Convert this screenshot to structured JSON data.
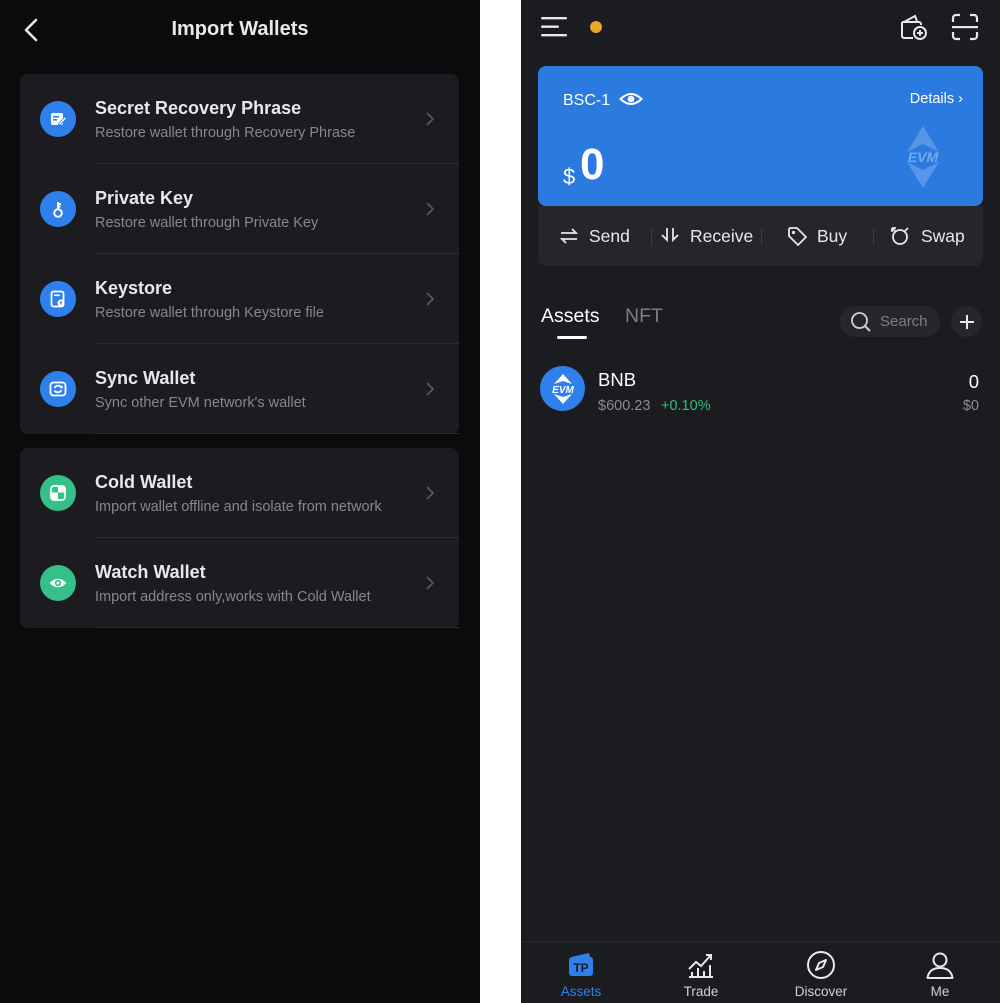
{
  "import": {
    "title": "Import Wallets",
    "groups": [
      [
        {
          "title": "Secret Recovery Phrase",
          "subtitle": "Restore wallet through Recovery Phrase",
          "icon": "document-edit-icon"
        },
        {
          "title": "Private Key",
          "subtitle": "Restore wallet through Private Key",
          "icon": "key-icon"
        },
        {
          "title": "Keystore",
          "subtitle": "Restore wallet through Keystore file",
          "icon": "keystore-file-icon"
        },
        {
          "title": "Sync Wallet",
          "subtitle": "Sync other EVM network's wallet",
          "icon": "sync-icon"
        }
      ],
      [
        {
          "title": "Cold Wallet",
          "subtitle": "Import wallet offline and isolate from network",
          "icon": "cold-wallet-icon"
        },
        {
          "title": "Watch Wallet",
          "subtitle": "Import address only,works with Cold Wallet",
          "icon": "eye-icon"
        }
      ]
    ]
  },
  "wallet": {
    "name": "BSC-1",
    "details_label": "Details",
    "currency": "$",
    "balance": "0",
    "actions": {
      "send": "Send",
      "receive": "Receive",
      "buy": "Buy",
      "swap": "Swap"
    },
    "tabs": {
      "assets": "Assets",
      "nft": "NFT"
    },
    "search_placeholder": "Search",
    "tokens": [
      {
        "symbol": "BNB",
        "price": "$600.23",
        "change": "+0.10%",
        "amount": "0",
        "value": "$0",
        "logo_text": "EVM"
      }
    ]
  },
  "nav": {
    "items": [
      {
        "label": "Assets",
        "icon": "assets-icon",
        "active": true
      },
      {
        "label": "Trade",
        "icon": "trade-chart-icon",
        "active": false
      },
      {
        "label": "Discover",
        "icon": "compass-icon",
        "active": false
      },
      {
        "label": "Me",
        "icon": "user-icon",
        "active": false
      }
    ]
  },
  "colors": {
    "accent": "#2f80ed",
    "card_blue": "#2b7ae0",
    "positive": "#2fbf7a",
    "notification": "#e5a823",
    "icon_green": "#35c08a"
  }
}
